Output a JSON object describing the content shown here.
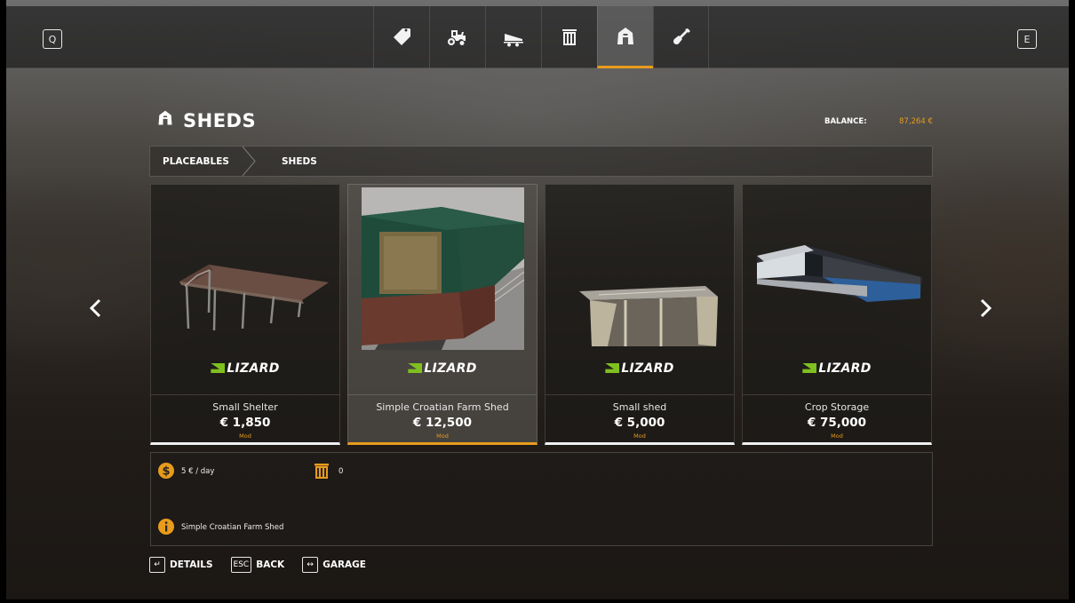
{
  "topbar": {
    "key_left": "Q",
    "key_right": "E",
    "tabs": [
      {
        "icon": "price-tag-icon"
      },
      {
        "icon": "tractor-icon"
      },
      {
        "icon": "trailer-icon"
      },
      {
        "icon": "storage-icon"
      },
      {
        "icon": "shed-icon",
        "active": true
      },
      {
        "icon": "shovel-icon"
      }
    ]
  },
  "header": {
    "title": "SHEDS",
    "balance_label": "BALANCE:",
    "balance_value": "87,264 €"
  },
  "breadcrumb": [
    "PLACEABLES",
    "SHEDS"
  ],
  "cards": [
    {
      "name": "Small Shelter",
      "price": "€ 1,850",
      "tag": "Mod",
      "brand": "LIZARD"
    },
    {
      "name": "Simple Croatian Farm Shed",
      "price": "€ 12,500",
      "tag": "Mod",
      "brand": "LIZARD",
      "selected": true
    },
    {
      "name": "Small shed",
      "price": "€ 5,000",
      "tag": "Mod",
      "brand": "LIZARD"
    },
    {
      "name": "Crop Storage",
      "price": "€ 75,000",
      "tag": "Mod",
      "brand": "LIZARD"
    }
  ],
  "info": {
    "cost": "5 € / day",
    "capacity": "0",
    "description": "Simple Croatian Farm Shed"
  },
  "footer": [
    {
      "key": "↵",
      "label": "DETAILS"
    },
    {
      "key": "ESC",
      "label": "BACK"
    },
    {
      "key": "↔",
      "label": "GARAGE"
    }
  ],
  "colors": {
    "accent": "#e89b1c",
    "brand_green": "#7fbf1f"
  }
}
